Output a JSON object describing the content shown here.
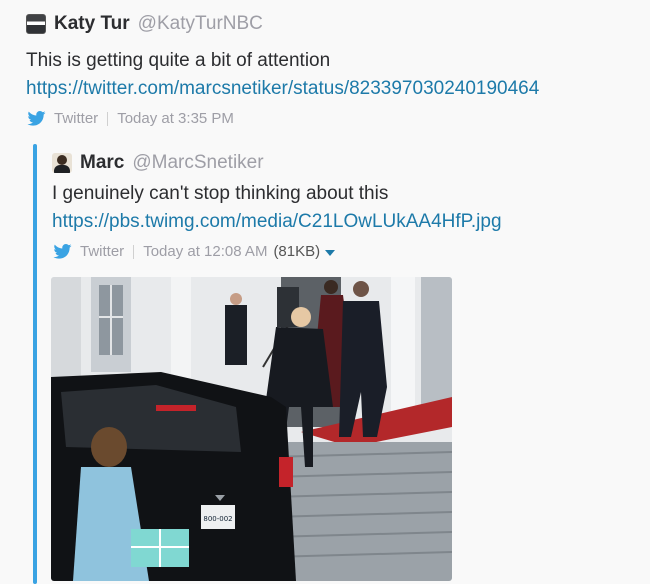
{
  "tweet": {
    "author_name": "Katy Tur",
    "author_handle": "@KatyTurNBC",
    "text": "This is getting quite a bit of attention",
    "link": "https://twitter.com/marcsnetiker/status/823397030240190464",
    "source": "Twitter",
    "timestamp": "Today at 3:35 PM"
  },
  "quoted": {
    "author_name": "Marc",
    "author_handle": "@MarcSnetiker",
    "text": "I genuinely can't stop thinking about this",
    "link": "https://pbs.twimg.com/media/C21LOwLUkAA4HfP.jpg",
    "source": "Twitter",
    "timestamp": "Today at 12:08 AM",
    "file_size": "(81KB)",
    "plate_text": "800-002"
  },
  "colors": {
    "link": "#1d7aa9",
    "quote_bar": "#3aa3e3",
    "muted": "#9e9ea6",
    "text": "#2c2d30"
  },
  "icons": {
    "source_icon": "twitter-bird-icon",
    "dropdown_icon": "caret-down-icon"
  }
}
